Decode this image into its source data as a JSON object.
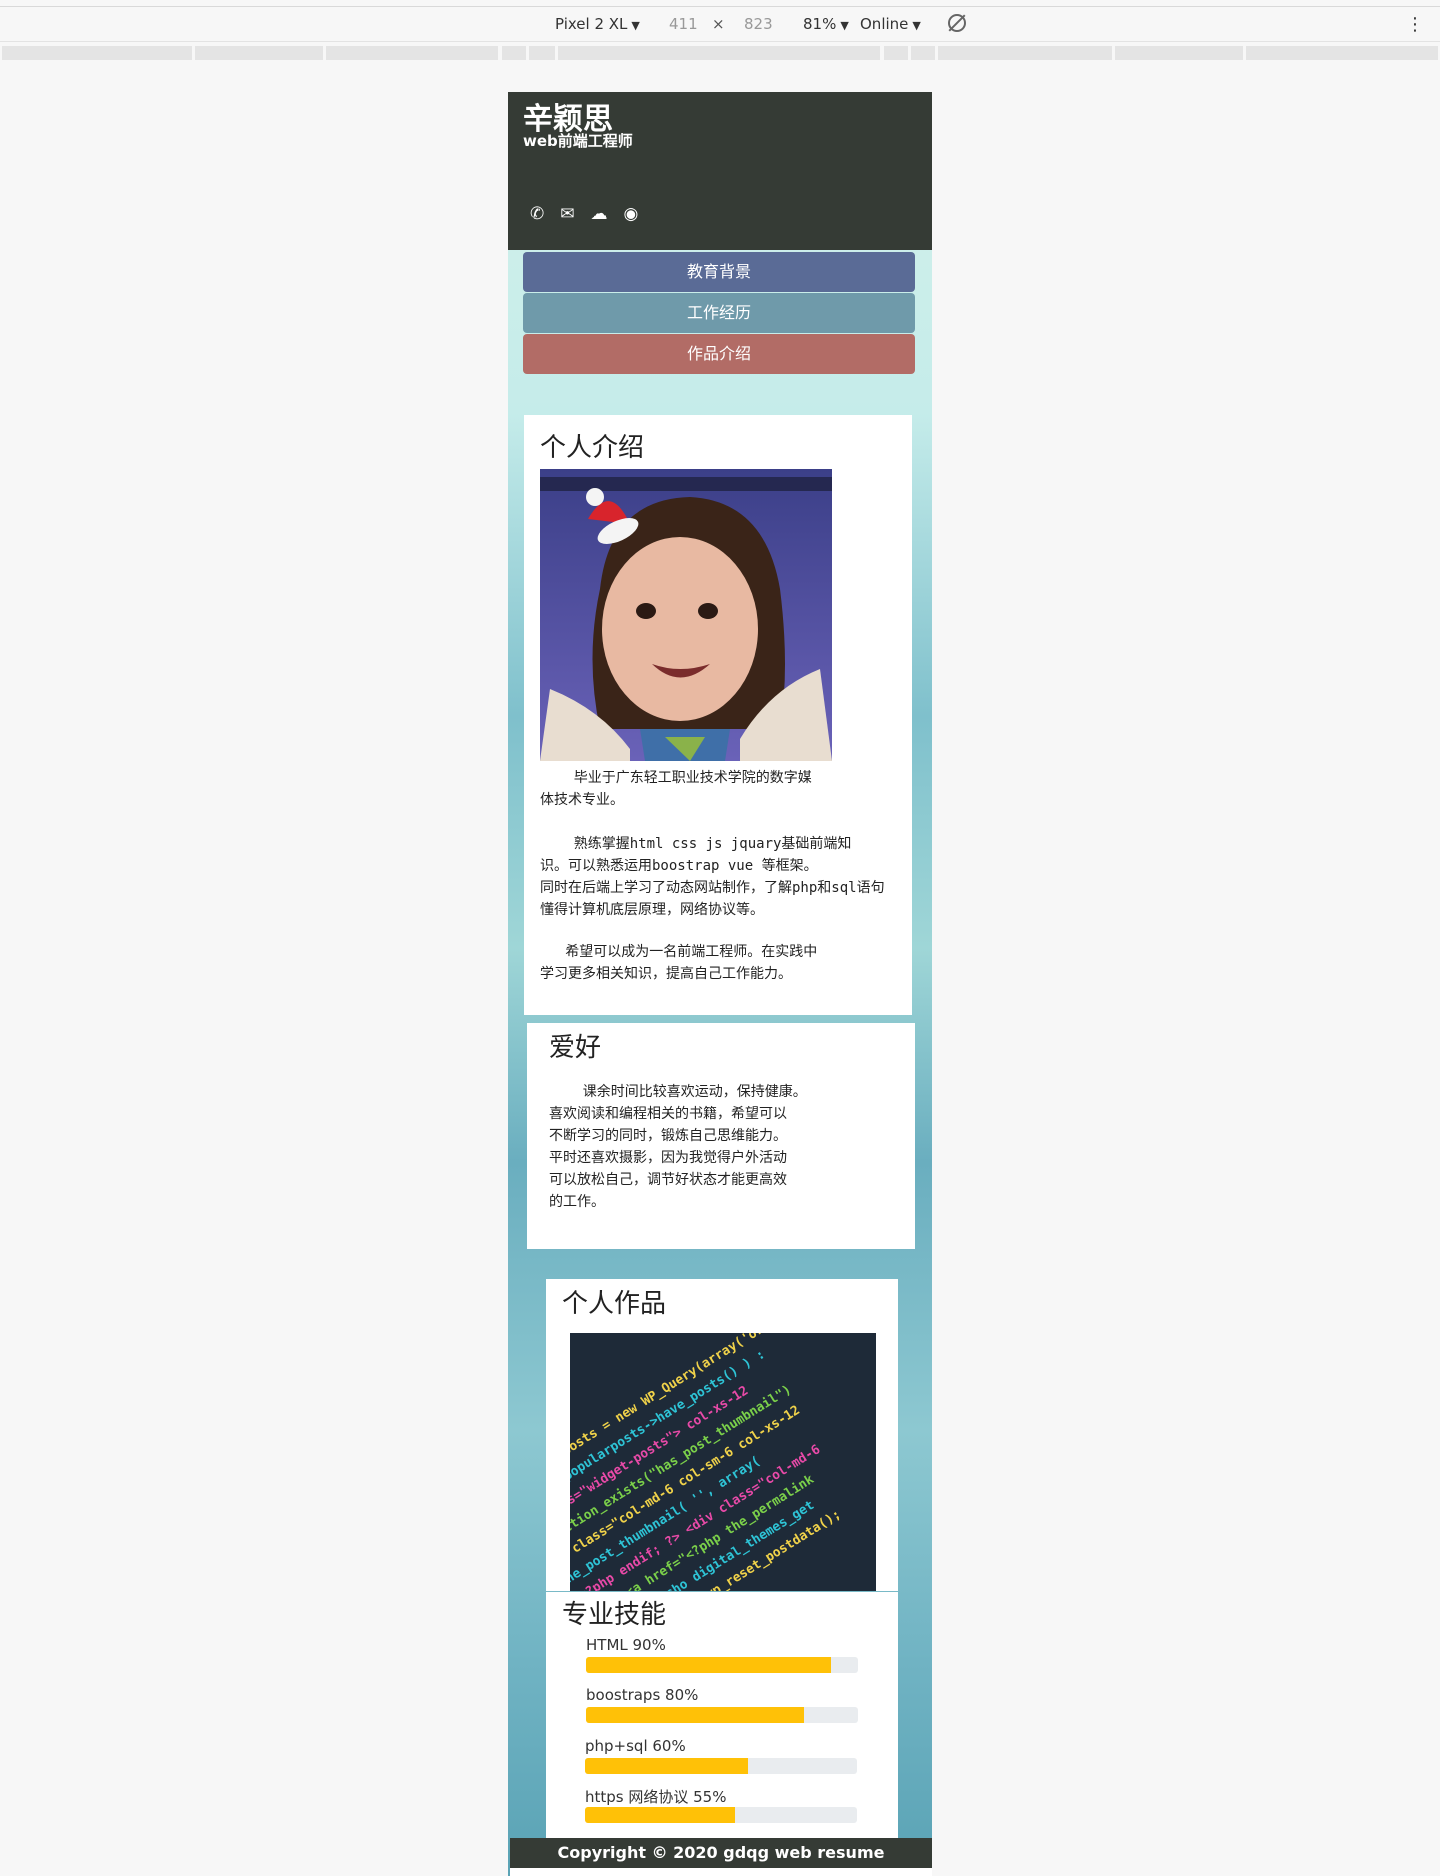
{
  "devtools": {
    "device": "Pixel 2 XL",
    "width": "411",
    "times": "×",
    "height": "823",
    "zoom": "81%",
    "throttle": "Online"
  },
  "resume": {
    "name": "辛颖思",
    "role": "web前端工程师",
    "contact_icons": [
      "phone-icon",
      "envelope-icon",
      "wechat-icon",
      "github-icon"
    ],
    "nav": {
      "education": "教育背景",
      "work": "工作经历",
      "works": "作品介绍"
    },
    "nav_colors": {
      "education": "#5a6b96",
      "work": "#6f9aaa",
      "works": "#b26c66"
    },
    "intro": {
      "title": "个人介绍",
      "p1": "    毕业于广东轻工职业技术学院的数字媒\n体技术专业。",
      "p2": "    熟练掌握html css js jquary基础前端知\n识。可以熟悉运用boostrap vue 等框架。\n同时在后端上学习了动态网站制作，了解php和sql语句\n懂得计算机底层原理，网络协议等。",
      "p3": "   希望可以成为一名前端工程师。在实践中\n学习更多相关知识，提高自己工作能力。"
    },
    "hobby": {
      "title": "爱好",
      "text": "    课余时间比较喜欢运动，保持健康。\n喜欢阅读和编程相关的书籍，希望可以\n不断学习的同时，锻炼自己思维能力。\n平时还喜欢摄影，因为我觉得户外活动\n可以放松自己，调节好状态才能更高效\n的工作。"
    },
    "portfolio": {
      "title": "个人作品"
    },
    "skills": {
      "title": "专业技能",
      "items": [
        {
          "label": "HTML 90%",
          "value": 0.9
        },
        {
          "label": "boostraps 80%",
          "value": 0.8
        },
        {
          "label": "php+sql 60%",
          "value": 0.6
        },
        {
          "label": "https 网络协议 55%",
          "value": 0.55
        }
      ]
    },
    "footer": "Copyright © 2020 gdqg web resume"
  }
}
